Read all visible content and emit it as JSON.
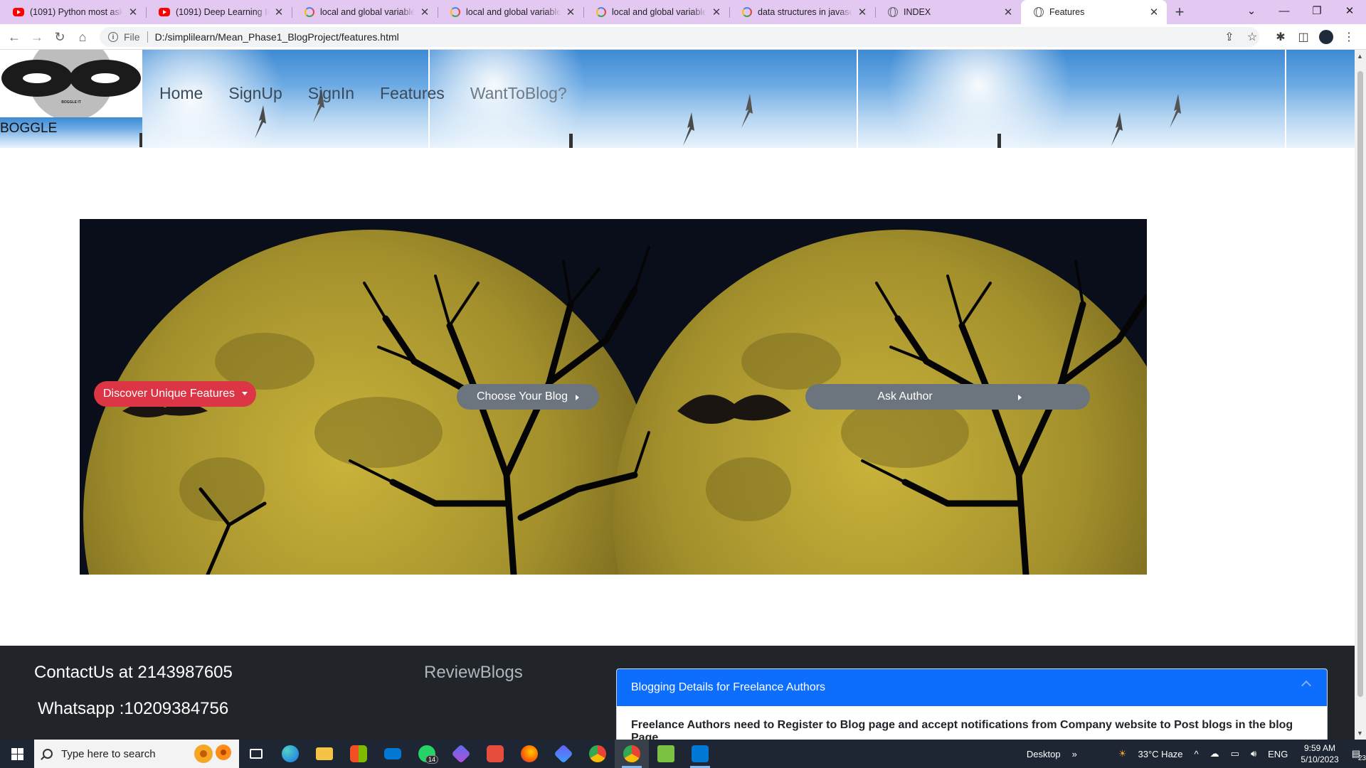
{
  "browser": {
    "tabs": [
      {
        "title": "(1091) Python most asked",
        "favicon": "youtube-icon"
      },
      {
        "title": "(1091) Deep Learning Inter",
        "favicon": "youtube-icon"
      },
      {
        "title": "local and global variables",
        "favicon": "google-icon"
      },
      {
        "title": "local and global variables",
        "favicon": "google-icon"
      },
      {
        "title": "local and global variables",
        "favicon": "google-icon"
      },
      {
        "title": "data structures in javascrip",
        "favicon": "google-icon"
      },
      {
        "title": "INDEX",
        "favicon": "globe-icon"
      },
      {
        "title": "Features",
        "favicon": "globe-icon",
        "active": true
      }
    ],
    "address": {
      "scheme": "File",
      "url": "D:/simplilearn/Mean_Phase1_BlogProject/features.html"
    }
  },
  "header": {
    "logo_text": "BOGGLE IT",
    "brand": "BOGGLE",
    "nav": [
      "Home",
      "SignUp",
      "SignIn",
      "Features",
      "WantToBlog?"
    ]
  },
  "hero": {
    "buttons": {
      "discover": "Discover Unique Features",
      "choose": "Choose Your Blog",
      "ask": "Ask Author"
    }
  },
  "footer": {
    "contact": "ContactUs at 2143987605",
    "whatsapp": "Whatsapp :10209384756",
    "review": "ReviewBlogs",
    "accordion": {
      "title": "Blogging Details for Freelance Authors",
      "body": "Freelance Authors need to Register to Blog page and accept notifications from Company website to Post blogs in the blog Page"
    }
  },
  "taskbar": {
    "search_placeholder": "Type here to search",
    "whatsapp_badge": "14",
    "desktop_label": "Desktop",
    "weather": "33°C  Haze",
    "language": "ENG",
    "time": "9:59 AM",
    "date": "5/10/2023",
    "notifications": "23"
  },
  "colors": {
    "tab_strip": "#e3c9f1",
    "danger_button": "#dc3545",
    "secondary_button": "#6c757d",
    "footer_bg": "#212529",
    "accordion_header": "#0d6efd"
  }
}
